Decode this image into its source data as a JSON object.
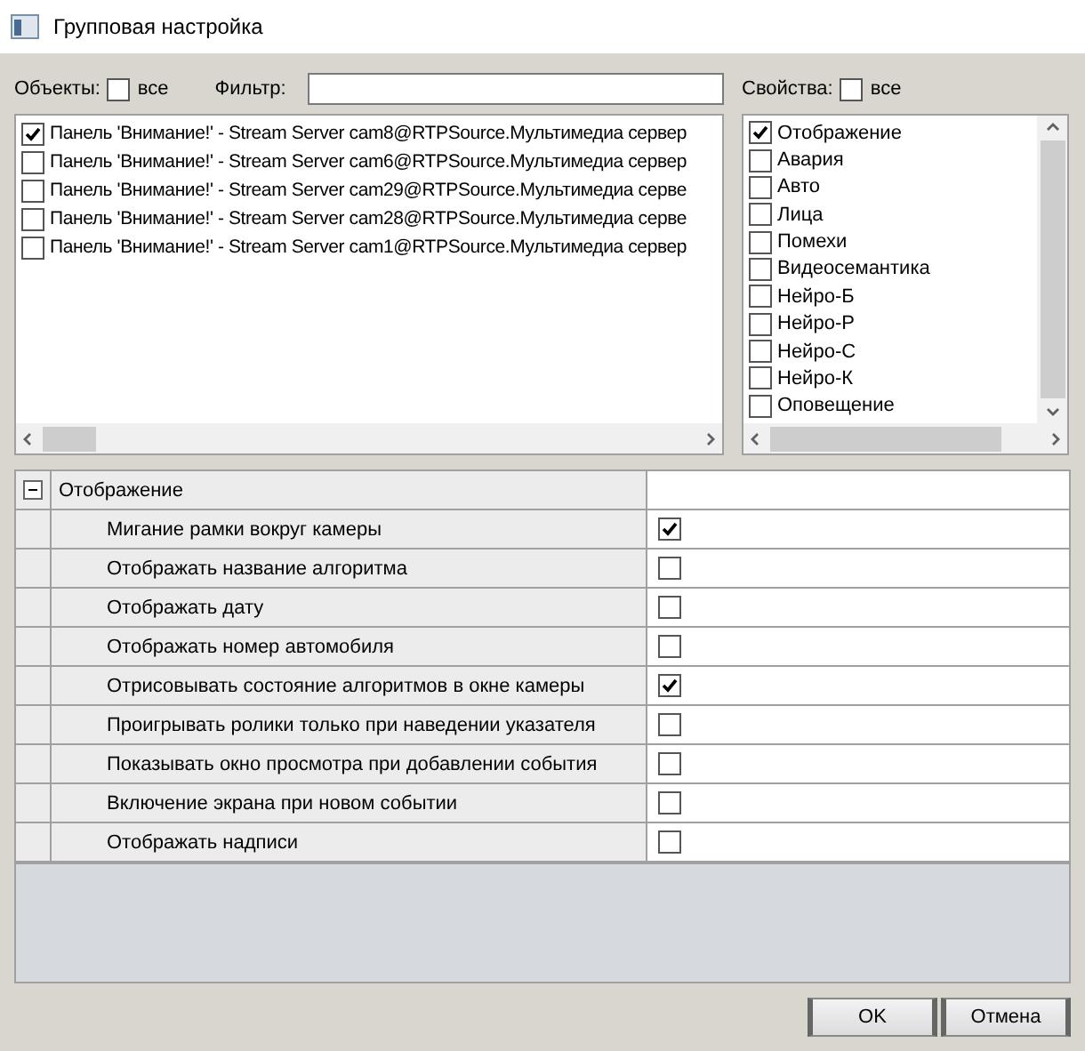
{
  "window": {
    "title": "Групповая настройка"
  },
  "objects": {
    "label": "Объекты:",
    "all_label": "все",
    "all_checked": false,
    "filter_label": "Фильтр:",
    "items": [
      {
        "label": "Панель 'Внимание!' - Stream Server cam8@RTPSource.Мультимедиа сервер",
        "checked": true
      },
      {
        "label": "Панель 'Внимание!' - Stream Server cam6@RTPSource.Мультимедиа сервер",
        "checked": false
      },
      {
        "label": "Панель 'Внимание!' - Stream Server cam29@RTPSource.Мультимедиа серве",
        "checked": false
      },
      {
        "label": "Панель 'Внимание!' - Stream Server cam28@RTPSource.Мультимедиа серве",
        "checked": false
      },
      {
        "label": "Панель 'Внимание!' - Stream Server cam1@RTPSource.Мультимедиа сервер",
        "checked": false
      }
    ]
  },
  "properties": {
    "label": "Свойства:",
    "all_label": "все",
    "all_checked": false,
    "items": [
      {
        "label": "Отображение",
        "checked": true
      },
      {
        "label": "Авария",
        "checked": false
      },
      {
        "label": "Авто",
        "checked": false
      },
      {
        "label": "Лица",
        "checked": false
      },
      {
        "label": "Помехи",
        "checked": false
      },
      {
        "label": "Видеосемантика",
        "checked": false
      },
      {
        "label": "Нейро-Б",
        "checked": false
      },
      {
        "label": "Нейро-Р",
        "checked": false
      },
      {
        "label": "Нейро-С",
        "checked": false
      },
      {
        "label": "Нейро-К",
        "checked": false
      },
      {
        "label": "Оповещение",
        "checked": false
      }
    ]
  },
  "grid": {
    "category": "Отображение",
    "expanded": true,
    "rows": [
      {
        "label": "Мигание рамки вокруг камеры",
        "checked": true
      },
      {
        "label": "Отображать название алгоритма",
        "checked": false
      },
      {
        "label": "Отображать дату",
        "checked": false
      },
      {
        "label": "Отображать номер автомобиля",
        "checked": false
      },
      {
        "label": "Отрисовывать состояние алгоритмов в окне камеры",
        "checked": true
      },
      {
        "label": "Проигрывать ролики только при наведении указателя",
        "checked": false
      },
      {
        "label": "Показывать окно просмотра при добавлении события",
        "checked": false
      },
      {
        "label": "Включение экрана при новом событии",
        "checked": false
      },
      {
        "label": "Отображать надписи",
        "checked": false
      }
    ]
  },
  "buttons": [
    "OK",
    "Отмена"
  ]
}
